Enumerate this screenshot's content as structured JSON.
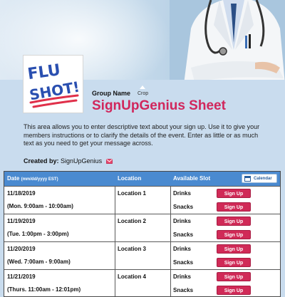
{
  "header": {
    "group_label": "Group Name",
    "crop_label": "Crop",
    "title": "SignUpGenius Sheet"
  },
  "logo": {
    "text_line1": "FLU",
    "text_line2": "SHOT!"
  },
  "description": "This area allows you to enter descriptive text about your sign up. Use it to give your members instructions or to clarify the details of the event. Enter as little or as much text as you need to get your message across.",
  "created_by": {
    "label": "Created by:",
    "name": "SignUpGenius"
  },
  "table": {
    "columns": {
      "date": "Date",
      "date_format": "(mm/dd/yyyy EST)",
      "location": "Location",
      "slot": "Available Slot"
    },
    "calendar_button": "Calendar",
    "rows": [
      {
        "date": "11/18/2019",
        "time": "(Mon. 9:00am - 10:00am)",
        "location": "Location 1",
        "slot1": "Drinks",
        "slot2": "Snacks",
        "btn": "Sign Up"
      },
      {
        "date": "11/19/2019",
        "time": "(Tue. 1:00pm - 3:00pm)",
        "location": "Location 2",
        "slot1": "Drinks",
        "slot2": "Snacks",
        "btn": "Sign Up"
      },
      {
        "date": "11/20/2019",
        "time": "(Wed. 7:00am - 9:00am)",
        "location": "Location 3",
        "slot1": "Drinks",
        "slot2": "Snacks",
        "btn": "Sign Up"
      },
      {
        "date": "11/21/2019",
        "time": "(Thurs. 11:00am - 12:01pm)",
        "location": "Location 4",
        "slot1": "Drinks",
        "slot2": "Snacks",
        "btn": "Sign Up"
      }
    ]
  },
  "colors": {
    "accent": "#d1265c",
    "table_header": "#4a8ad0",
    "background": "#c9dcee"
  },
  "icons": {
    "mail": "mail-icon",
    "calendar": "calendar-icon"
  }
}
